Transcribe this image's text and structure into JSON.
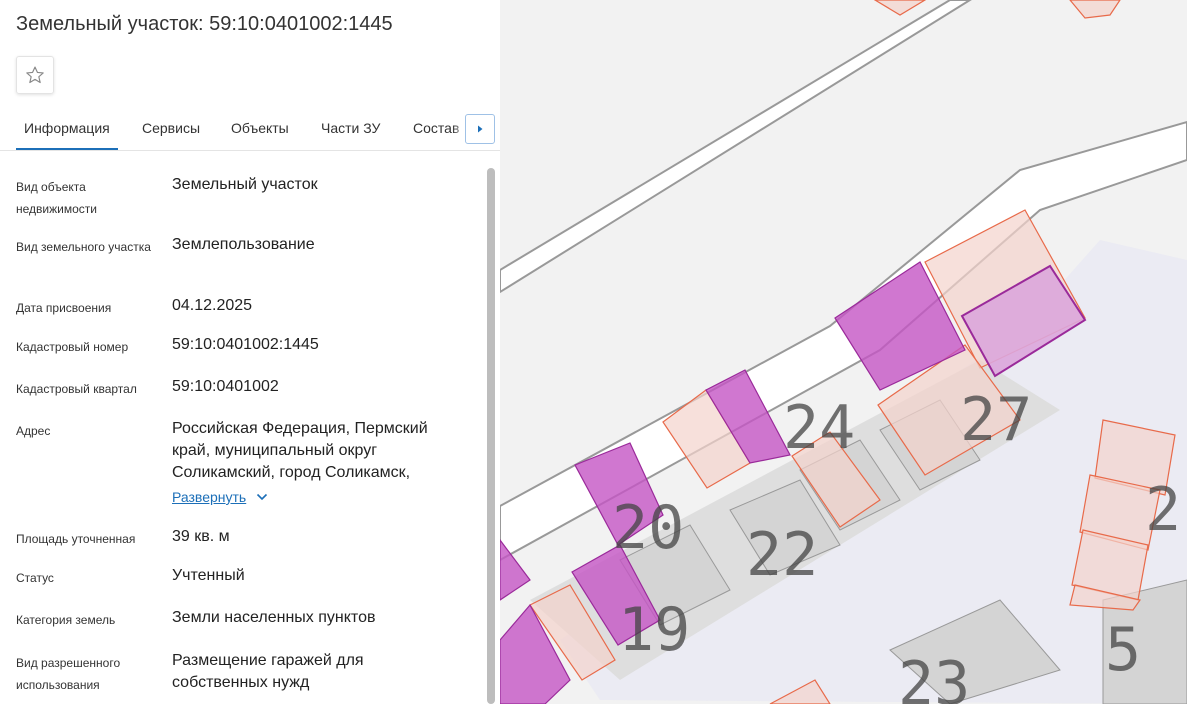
{
  "header": {
    "title": "Земельный участок: 59:10:0401002:1445"
  },
  "icons": {
    "favorite": "star-outline-icon",
    "next_tab": "caret-right-icon",
    "expand": "chevron-down-icon"
  },
  "tabs": [
    {
      "label": "Информация",
      "active": true
    },
    {
      "label": "Сервисы"
    },
    {
      "label": "Объекты"
    },
    {
      "label": "Части ЗУ"
    },
    {
      "label": "Состав"
    }
  ],
  "info": {
    "object_type": {
      "label": "Вид объекта недвижимости",
      "value": "Земельный участок"
    },
    "land_type": {
      "label": "Вид земельного участка",
      "value": "Землепользование"
    },
    "date_assigned": {
      "label": "Дата присвоения",
      "value": "04.12.2025"
    },
    "cadastral_number": {
      "label": "Кадастровый номер",
      "value": "59:10:0401002:1445"
    },
    "cadastral_block": {
      "label": "Кадастровый квартал",
      "value": "59:10:0401002"
    },
    "address": {
      "label": "Адрес",
      "value": "Российская Федерация, Пермский край, муниципальный округ Соликамский, город Соликамск,",
      "expand_label": "Развернуть"
    },
    "area": {
      "label": "Площадь уточненная",
      "value": "39 кв. м"
    },
    "status": {
      "label": "Статус",
      "value": "Учтенный"
    },
    "land_category": {
      "label": "Категория земель",
      "value": "Земли населенных пунктов"
    },
    "permitted_use": {
      "label": "Вид разрешенного использования",
      "value": "Размещение гаражей для собственных нужд"
    }
  },
  "map": {
    "labels": [
      "24",
      "27",
      "20",
      "22",
      "19",
      "23",
      "2",
      "5"
    ],
    "colors": {
      "selected_fill": "#c455c4",
      "selected_stroke": "#9a2a9a",
      "parcel_stroke": "#e86a4a",
      "parcel_fill": "#f3d3cc",
      "accent": "#1c6fb8"
    }
  }
}
